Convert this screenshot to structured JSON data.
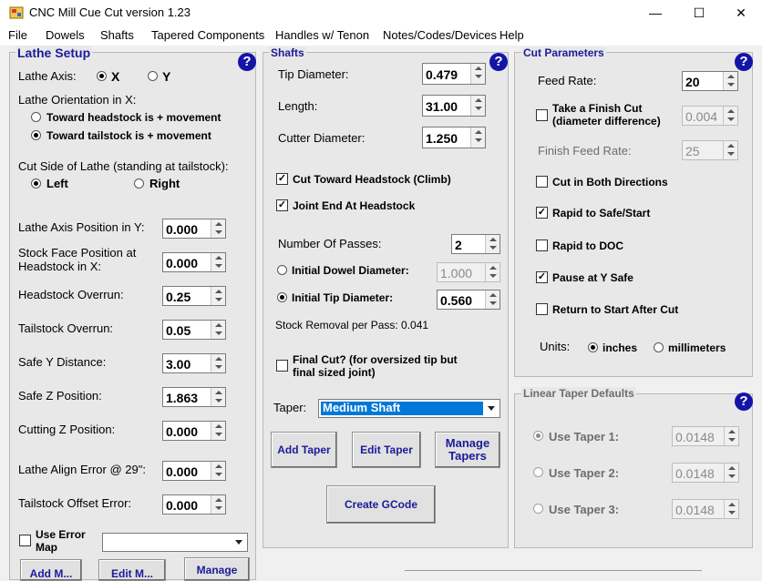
{
  "window": {
    "title": "CNC Mill Cue Cut version 1.23",
    "minimize": "—",
    "maximize": "☐",
    "close": "✕"
  },
  "menu": [
    "File",
    "Dowels",
    "Shafts",
    "Tapered Components",
    "Handles w/ Tenon",
    "Notes/Codes/Devices",
    "Help"
  ],
  "lathe_setup": {
    "title": "Lathe Setup",
    "help": "?",
    "axis_label": "Lathe Axis:",
    "axis_x": "X",
    "axis_y": "Y",
    "orientation_label": "Lathe Orientation in X:",
    "orient_headstock": "Toward headstock is + movement",
    "orient_tailstock": "Toward tailstock is + movement",
    "cut_side_label": "Cut Side of Lathe (standing at tailstock):",
    "side_left": "Left",
    "side_right": "Right",
    "fields": [
      {
        "label": "Lathe Axis Position in Y:",
        "value": "0.000"
      },
      {
        "label": "Stock Face Position at Headstock in X:",
        "value": "0.000"
      },
      {
        "label": "Headstock Overrun:",
        "value": "0.25"
      },
      {
        "label": "Tailstock Overrun:",
        "value": "0.05"
      },
      {
        "label": "Safe Y Distance:",
        "value": "3.00"
      },
      {
        "label": "Safe Z Position:",
        "value": "1.863"
      },
      {
        "label": "Cutting Z Position:",
        "value": "0.000"
      },
      {
        "label": "Lathe Align Error @ 29\":",
        "value": "0.000"
      },
      {
        "label": "Tailstock Offset Error:",
        "value": "0.000"
      }
    ],
    "use_error_map": "Use Error Map",
    "error_map_value": "",
    "btn_add": "Add M...",
    "btn_edit": "Edit M...",
    "btn_manage": "Manage"
  },
  "shafts": {
    "title": "Shafts",
    "help": "?",
    "tip_diameter_label": "Tip Diameter:",
    "tip_diameter": "0.479",
    "length_label": "Length:",
    "length": "31.00",
    "cutter_diameter_label": "Cutter Diameter:",
    "cutter_diameter": "1.250",
    "cut_toward_headstock": "Cut Toward Headstock (Climb)",
    "joint_end_at_headstock": "Joint End At Headstock",
    "passes_label": "Number Of Passes:",
    "passes": "2",
    "initial_dowel_label": "Initial Dowel Diameter:",
    "initial_dowel": "1.000",
    "initial_tip_label": "Initial Tip Diameter:",
    "initial_tip": "0.560",
    "stock_removal": "Stock Removal per Pass: 0.041",
    "final_cut": "Final Cut? (for oversized tip but final sized joint)",
    "taper_label": "Taper:",
    "taper_value": "Medium Shaft",
    "btn_add_taper": "Add Taper",
    "btn_edit_taper": "Edit Taper",
    "btn_manage_tapers": "Manage Tapers",
    "btn_create_gcode": "Create GCode"
  },
  "cut_params": {
    "title": "Cut Parameters",
    "help": "?",
    "feed_rate_label": "Feed Rate:",
    "feed_rate": "20",
    "finish_cut": "Take a Finish Cut (diameter difference)",
    "finish_cut_value": "0.004",
    "finish_feed_label": "Finish Feed Rate:",
    "finish_feed": "25",
    "cut_both": "Cut in Both Directions",
    "rapid_safe": "Rapid to Safe/Start",
    "rapid_doc": "Rapid to DOC",
    "pause_y_safe": "Pause at Y Safe",
    "return_start": "Return to Start After Cut",
    "units_label": "Units:",
    "units_inches": "inches",
    "units_mm": "millimeters"
  },
  "linear_taper": {
    "title": "Linear Taper Defaults",
    "help": "?",
    "taper1_label": "Use Taper 1:",
    "taper1": "0.0148",
    "taper2_label": "Use Taper 2:",
    "taper2": "0.0148",
    "taper3_label": "Use Taper 3:",
    "taper3": "0.0148"
  }
}
